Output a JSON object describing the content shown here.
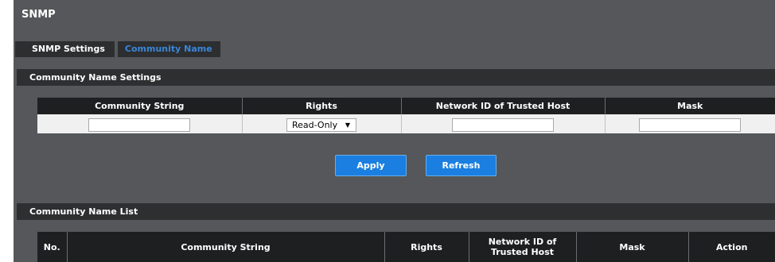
{
  "page": {
    "title": "SNMP"
  },
  "tabs": [
    {
      "label": "SNMP Settings",
      "active": false
    },
    {
      "label": "Community Name",
      "active": true
    }
  ],
  "settings": {
    "section_title": "Community Name Settings",
    "columns": [
      "Community String",
      "Rights",
      "Network ID of Trusted Host",
      "Mask"
    ],
    "inputs": {
      "community_string": "",
      "rights_selected": "Read-Only",
      "network_id": "",
      "mask": ""
    },
    "apply_label": "Apply",
    "refresh_label": "Refresh"
  },
  "list": {
    "section_title": "Community Name List",
    "columns": {
      "no": "No.",
      "community_string": "Community String",
      "rights": "Rights",
      "network_id_line1": "Network ID of",
      "network_id_line2": "Trusted Host",
      "mask": "Mask",
      "action": "Action"
    }
  },
  "colors": {
    "panel_bg": "#55575a",
    "header_bar": "#2e2f31",
    "table_header": "#1e1f21",
    "active_tab_text": "#3a86d9",
    "button": "#1a7fe0"
  },
  "icons": {
    "select_caret": "triangle-down-icon"
  }
}
